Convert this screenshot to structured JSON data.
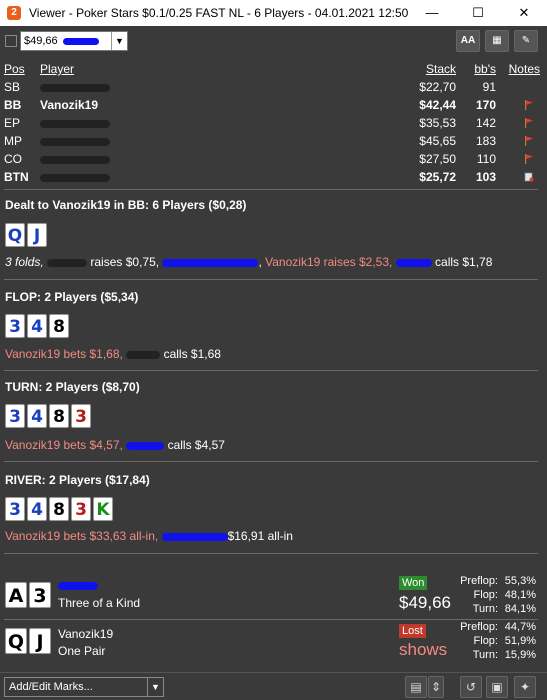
{
  "window": {
    "title": "Viewer - Poker Stars $0.1/0.25 FAST NL - 6 Players - 04.01.2021 12:50",
    "min_glyph": "—",
    "max_glyph": "☐",
    "close_glyph": "✕"
  },
  "toolbar": {
    "hand_value": "$49,66",
    "font_button": "AA",
    "grid_button": "▦",
    "edit_button": "✎"
  },
  "table": {
    "headers": {
      "pos": "Pos",
      "player": "Player",
      "stack": "Stack",
      "bbs": "bb's",
      "notes": "Notes"
    },
    "rows": [
      {
        "pos": "SB",
        "name": "",
        "stack": "$22,70",
        "bbs": "91",
        "bold": false,
        "flag": false
      },
      {
        "pos": "BB",
        "name": "Vanozik19",
        "stack": "$42,44",
        "bbs": "170",
        "bold": true,
        "flag": true
      },
      {
        "pos": "EP",
        "name": "",
        "stack": "$35,53",
        "bbs": "142",
        "bold": false,
        "flag": true
      },
      {
        "pos": "MP",
        "name": "",
        "stack": "$45,65",
        "bbs": "183",
        "bold": false,
        "flag": true
      },
      {
        "pos": "CO",
        "name": "",
        "stack": "$27,50",
        "bbs": "110",
        "bold": false,
        "flag": true
      },
      {
        "pos": "BTN",
        "name": "",
        "stack": "$25,72",
        "bbs": "103",
        "bold": true,
        "flag": false
      }
    ]
  },
  "preflop": {
    "title": "Dealt to Vanozik19 in BB: 6 Players ($0,28)",
    "cards": [
      "Q",
      "J"
    ],
    "a1": "3 folds,",
    "a2": "raises $0,75,",
    "a3": ",",
    "a4": "Vanozik19 raises $2,53,",
    "a5": "calls $1,78"
  },
  "flop": {
    "title": "FLOP: 2 Players ($5,34)",
    "cards": [
      "3",
      "4",
      "8"
    ],
    "a1": "Vanozik19 bets $1,68,",
    "a2": "calls $1,68"
  },
  "turn": {
    "title": "TURN: 2 Players ($8,70)",
    "cards": [
      "3",
      "4",
      "8",
      "3"
    ],
    "a1": "Vanozik19 bets $4,57,",
    "a2": "calls $4,57"
  },
  "river": {
    "title": "RIVER: 2 Players ($17,84)",
    "cards": [
      "3",
      "4",
      "8",
      "3",
      "K"
    ],
    "a1": "Vanozik19 bets $33,63 all-in,",
    "a2": "$16,91 all-in"
  },
  "showdown": [
    {
      "cards": [
        "A",
        "3"
      ],
      "name": "",
      "hand": "Three of a Kind",
      "badge": "Won",
      "amount": "$49,66",
      "stats": [
        {
          "label": "Preflop:",
          "value": "55,3%"
        },
        {
          "label": "Flop:",
          "value": "48,1%"
        },
        {
          "label": "Turn:",
          "value": "84,1%"
        }
      ]
    },
    {
      "cards": [
        "Q",
        "J"
      ],
      "name": "Vanozik19",
      "hand": "One Pair",
      "badge": "Lost",
      "amount": "shows",
      "stats": [
        {
          "label": "Preflop:",
          "value": "44,7%"
        },
        {
          "label": "Flop:",
          "value": "51,9%"
        },
        {
          "label": "Turn:",
          "value": "15,9%"
        }
      ]
    }
  ],
  "bottom": {
    "marks_label": "Add/Edit Marks..."
  },
  "colors": {
    "hero_action": "#f28b82",
    "won": "#2e8b2e",
    "lost": "#c0392b"
  }
}
